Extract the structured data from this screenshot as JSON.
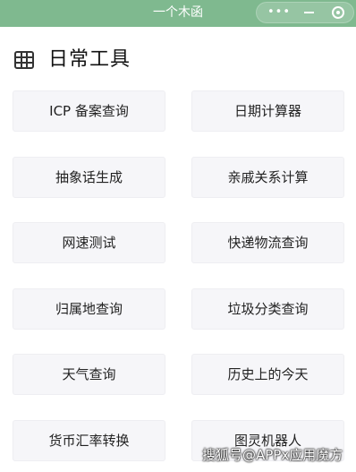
{
  "top_bar": {
    "title": "一个木函",
    "more_label": "•••",
    "bar_color": "#7fb98f"
  },
  "section": {
    "icon": "grid-icon",
    "title": "日常工具"
  },
  "tools": [
    {
      "label": "ICP 备案查询"
    },
    {
      "label": "日期计算器"
    },
    {
      "label": "抽象话生成"
    },
    {
      "label": "亲戚关系计算"
    },
    {
      "label": "网速测试"
    },
    {
      "label": "快递物流查询"
    },
    {
      "label": "归属地查询"
    },
    {
      "label": "垃圾分类查询"
    },
    {
      "label": "天气查询"
    },
    {
      "label": "历史上的今天"
    },
    {
      "label": "货币汇率转换"
    },
    {
      "label": "图灵机器人"
    }
  ],
  "watermark": "搜狐号@APPx应用魔方",
  "colors": {
    "button_bg": "#f6f6f9",
    "text": "#222222"
  }
}
